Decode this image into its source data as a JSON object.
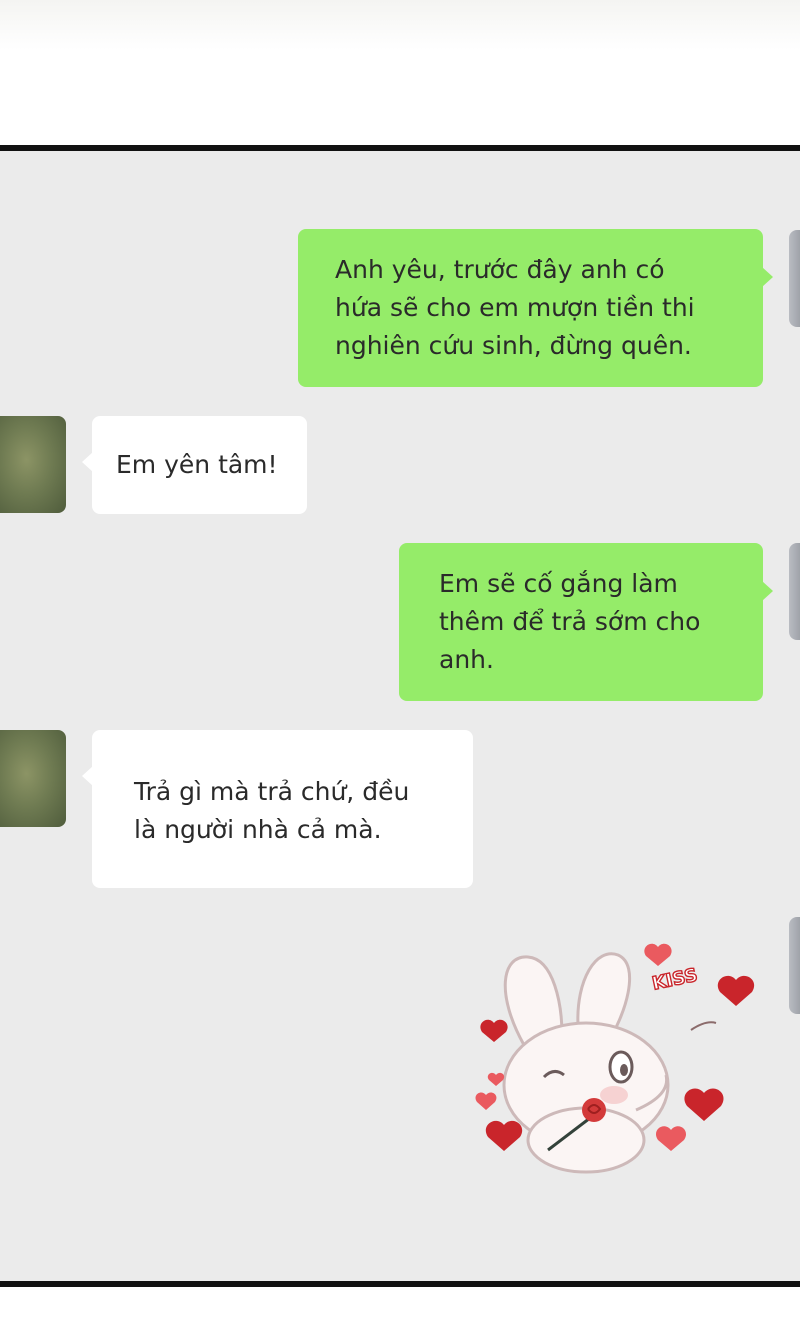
{
  "messages": [
    {
      "sender": "me",
      "text": "Anh yêu, trước đây anh có\nhứa sẽ cho em mượn tiền thi\nnghiên cứu sinh, đừng quên."
    },
    {
      "sender": "other",
      "text": "Em yên tâm!"
    },
    {
      "sender": "me",
      "text": "Em sẽ cố gắng làm\nthêm để trả sớm cho\nanh."
    },
    {
      "sender": "other",
      "text": "Trả gì mà trả chứ, đều\nlà người nhà cả mà."
    }
  ],
  "sticker": {
    "icon": "bunny-kiss-sticker-icon",
    "label": "KISS"
  },
  "colors": {
    "outgoing_bubble": "#95ec69",
    "incoming_bubble": "#ffffff",
    "chat_background": "#ebebeb",
    "heart": "#c9252b"
  }
}
